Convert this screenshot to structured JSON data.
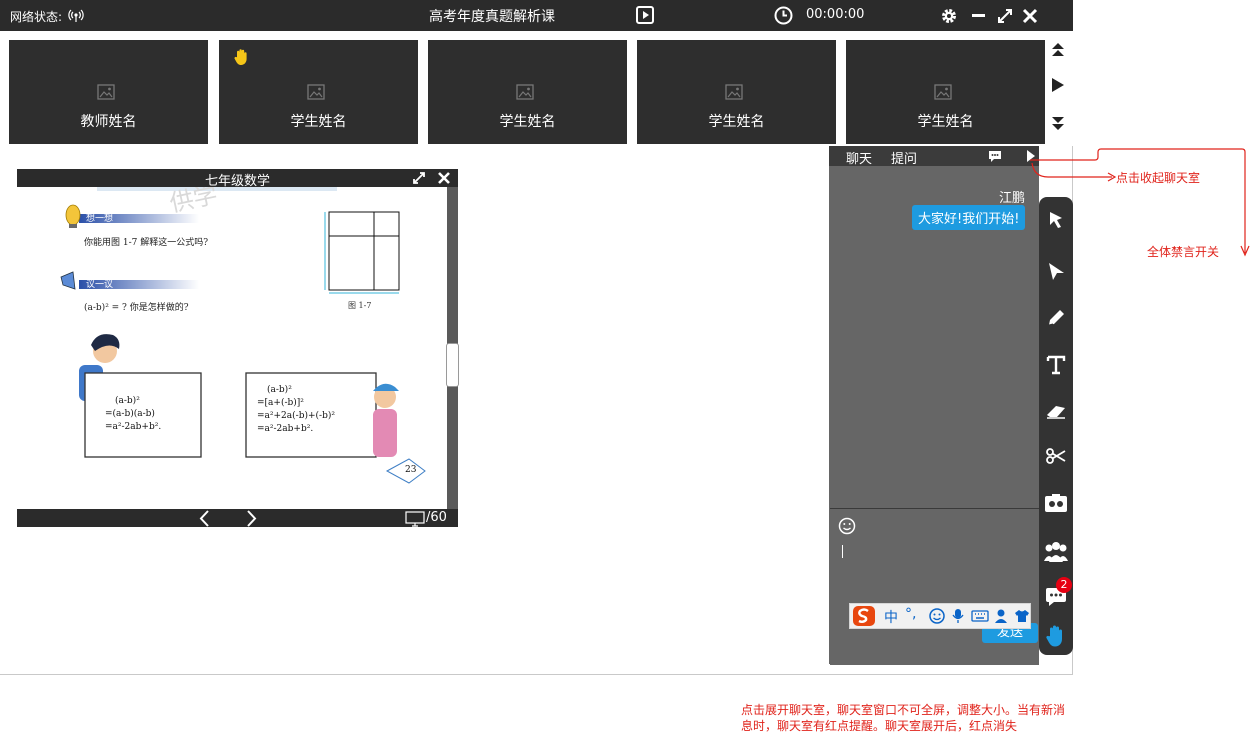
{
  "titlebar": {
    "network_label": "网络状态:",
    "title": "高考年度真题解析课",
    "timer": "00:00:00"
  },
  "video_tiles": [
    {
      "label": "教师姓名",
      "raised_hand": false
    },
    {
      "label": "学生姓名",
      "raised_hand": true
    },
    {
      "label": "学生姓名",
      "raised_hand": false
    },
    {
      "label": "学生姓名",
      "raised_hand": false
    },
    {
      "label": "学生姓名",
      "raised_hand": false
    }
  ],
  "document": {
    "title": "七年级数学",
    "page_total": "/60",
    "watermark": "供学",
    "think_heading": "想一想",
    "think_text": "你能用图 1-7 解释这一公式吗?",
    "discuss_heading": "议一议",
    "discuss_text": "(a-b)² = ? 你是怎样做的?",
    "figure_caption": "图 1-7",
    "board_left": [
      "(a-b)²",
      "=(a-b)(a-b)",
      "=a²-2ab+b²."
    ],
    "board_right": [
      "(a-b)²",
      "=[a+(-b)]²",
      "=a²+2a(-b)+(-b)²",
      "=a²-2ab+b²."
    ],
    "page_number": "23"
  },
  "chat": {
    "tab_chat": "聊天",
    "tab_question": "提问",
    "sender": "江鹏",
    "message": "大家好!我们开始!",
    "send_label": "发送",
    "unread_badge": "2"
  },
  "annotations": {
    "collapse": "点击收起聊天室",
    "mute_all": "全体禁言开关",
    "note_line1": "点击展开聊天室，聊天室窗口不可全屏，调整大小。当有新消",
    "note_line2": "息时，聊天室有红点提醒。聊天室展开后，红点消失"
  },
  "colors": {
    "titlebar": "#2b2b2b",
    "tile": "#2e2e2e",
    "chat_bg": "#666666",
    "accent_blue": "#1e9be0",
    "annotation_red": "#e0231b",
    "badge_red": "#e60012",
    "hand_yellow": "#f5c518"
  }
}
